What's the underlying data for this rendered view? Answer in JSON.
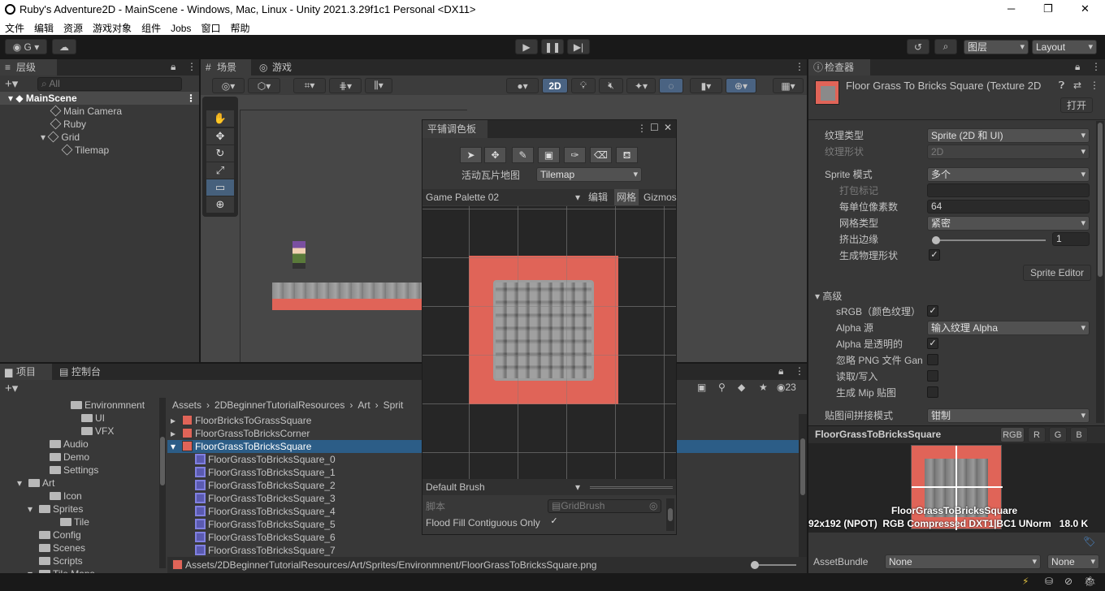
{
  "window": {
    "title": "Ruby's Adventure2D - MainScene - Windows, Mac, Linux - Unity 2021.3.29f1c1 Personal <DX11>",
    "min": "─",
    "max": "❐",
    "close": "✕"
  },
  "menu": [
    "文件",
    "编辑",
    "资源",
    "游戏对象",
    "组件",
    "Jobs",
    "窗口",
    "帮助"
  ],
  "toolbar": {
    "account": "G",
    "layers": "图层",
    "layout": "Layout"
  },
  "hierarchy": {
    "tab": "层级",
    "search_placeholder": "All",
    "scene": "MainScene",
    "items": [
      "Main Camera",
      "Ruby",
      "Grid",
      "Tilemap"
    ]
  },
  "scene_tabs": {
    "scene": "场景",
    "game": "游戏",
    "btn2d": "2D"
  },
  "tile_palette": {
    "title": "平铺调色板",
    "active_label": "活动瓦片地图",
    "active_value": "Tilemap",
    "palette": "Game Palette 02",
    "edit": "编辑",
    "grid": "网格",
    "gizmos": "Gizmos",
    "brush": "Default Brush",
    "script_label": "脚本",
    "script_value": "GridBrush",
    "flood_label": "Flood Fill Contiguous Only",
    "flood_checked": "✓"
  },
  "inspector": {
    "tab": "检查器",
    "title": "Floor Grass To Bricks Square (Texture 2D",
    "open": "打开",
    "props": [
      {
        "label": "纹理类型",
        "value": "Sprite (2D 和 UI)"
      },
      {
        "label": "纹理形状",
        "value": "2D"
      },
      {
        "label": "Sprite 模式",
        "value": "多个"
      },
      {
        "label": "打包标记",
        "value": ""
      },
      {
        "label": "每单位像素数",
        "value": "64"
      },
      {
        "label": "网格类型",
        "value": "紧密"
      },
      {
        "label": "挤出边缘",
        "value": "1"
      },
      {
        "label": "生成物理形状",
        "value": "✓"
      }
    ],
    "sprite_editor": "Sprite Editor",
    "advanced": "高级",
    "adv": [
      {
        "label": "sRGB（颜色纹理）",
        "value": "✓"
      },
      {
        "label": "Alpha 源",
        "value": "输入纹理 Alpha"
      },
      {
        "label": "Alpha 是透明的",
        "value": "✓"
      },
      {
        "label": "忽略 PNG 文件 Gan",
        "value": ""
      },
      {
        "label": "读取/写入",
        "value": ""
      },
      {
        "label": "生成 Mip 贴图",
        "value": ""
      }
    ],
    "wrap_label": "贴图间拼接模式",
    "wrap_value": "钳制",
    "preview_title": "FloorGrassToBricksSquare",
    "channels": [
      "RGB",
      "R",
      "G",
      "B"
    ],
    "preview_name": "FloorGrassToBricksSquare",
    "preview_info": "92x192 (NPOT)  RGB Compressed DXT1|BC1 UNorm   18.0 K",
    "assetbundle_label": "AssetBundle",
    "ab1": "None",
    "ab2": "None"
  },
  "project": {
    "tab": "项目",
    "console": "控制台",
    "count": "23",
    "tree": [
      {
        "t": "Environmnent",
        "l": 5
      },
      {
        "t": "UI",
        "l": 6
      },
      {
        "t": "VFX",
        "l": 6
      },
      {
        "t": "Audio",
        "l": 3
      },
      {
        "t": "Demo",
        "l": 3
      },
      {
        "t": "Settings",
        "l": 3
      },
      {
        "t": "Art",
        "l": 1
      },
      {
        "t": "Icon",
        "l": 3
      },
      {
        "t": "Sprites",
        "l": 2
      },
      {
        "t": "Tile",
        "l": 4
      },
      {
        "t": "Config",
        "l": 2
      },
      {
        "t": "Scenes",
        "l": 2
      },
      {
        "t": "Scripts",
        "l": 2
      },
      {
        "t": "Tile Maps",
        "l": 2
      }
    ],
    "breadcrumb": [
      "Assets",
      "2DBeginnerTutorialResources",
      "Art",
      "Sprit"
    ],
    "files": [
      "FloorBricksToGrassSquare",
      "FloorGrassToBricksCorner",
      "FloorGrassToBricksSquare",
      "FloorGrassToBricksSquare_0",
      "FloorGrassToBricksSquare_1",
      "FloorGrassToBricksSquare_2",
      "FloorGrassToBricksSquare_3",
      "FloorGrassToBricksSquare_4",
      "FloorGrassToBricksSquare_5",
      "FloorGrassToBricksSquare_6",
      "FloorGrassToBricksSquare_7"
    ],
    "path": "Assets/2DBeginnerTutorialResources/Art/Sprites/Environmnent/FloorGrassToBricksSquare.png"
  }
}
